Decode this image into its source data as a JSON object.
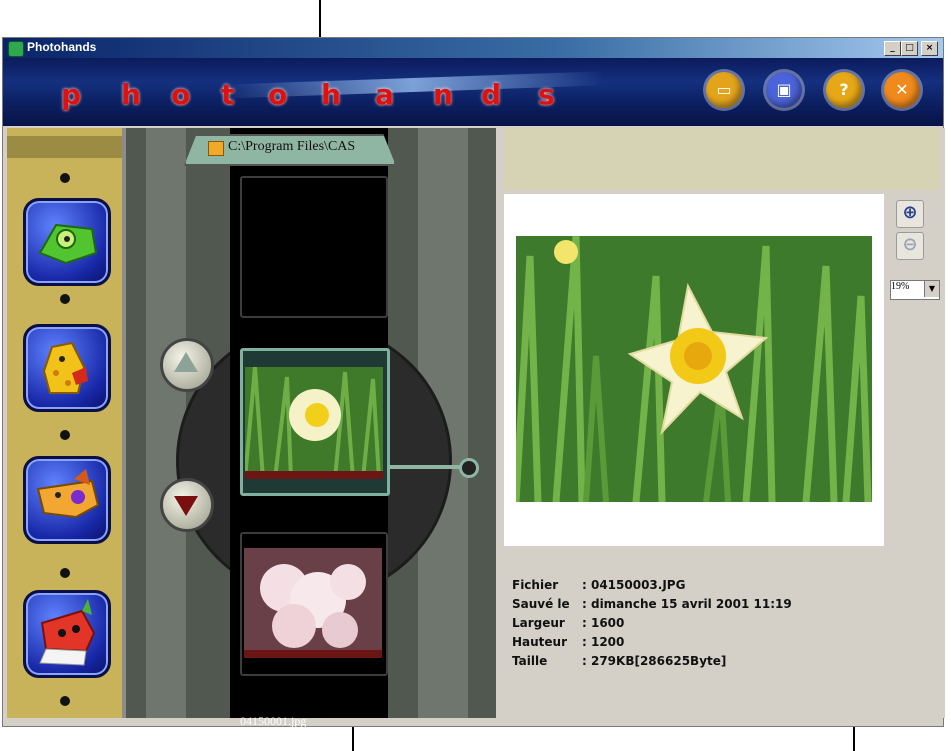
{
  "window": {
    "title": "Photohands",
    "minimize": "_",
    "maximize": "□",
    "close": "×"
  },
  "banner": {
    "logo_letters": [
      "p",
      "h",
      "o",
      "t",
      "o",
      "h",
      "a",
      "n",
      "d",
      "s"
    ],
    "buttons": [
      {
        "name": "open-folder-icon",
        "glyph": "▭",
        "color": "#e3a41c"
      },
      {
        "name": "save-icon",
        "glyph": "▣",
        "color": "#4b63d8"
      },
      {
        "name": "help-icon",
        "glyph": "?",
        "color": "#e6a817"
      },
      {
        "name": "close-icon",
        "glyph": "✕",
        "color": "#f08a1c"
      }
    ]
  },
  "folder": {
    "path": "C:\\Program Files\\CAS"
  },
  "filmstrip": {
    "thumbnail_label": "04150001.jpg"
  },
  "zoom": {
    "level": "19%"
  },
  "info": {
    "rows": [
      {
        "key": "Fichier",
        "value": ": 04150003.JPG"
      },
      {
        "key": "Sauvé le",
        "value": ": dimanche 15 avril 2001 11:19"
      },
      {
        "key": "Largeur",
        "value": ": 1600"
      },
      {
        "key": "Hauteur",
        "value": ": 1200"
      },
      {
        "key": "Taille",
        "value": ": 279KB[286625Byte]"
      }
    ]
  }
}
